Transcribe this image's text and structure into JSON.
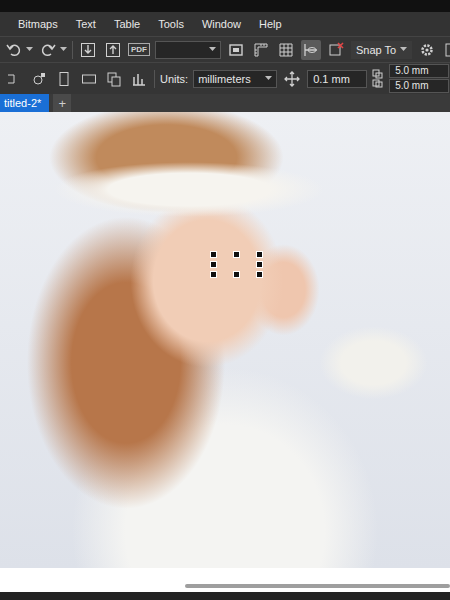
{
  "menu": [
    "Bitmaps",
    "Text",
    "Table",
    "Tools",
    "Window",
    "Help"
  ],
  "standard_toolbar": {
    "pdf_label": "PDF",
    "zoom_value": "",
    "view_toggle_on": true,
    "snap_to": "Snap To"
  },
  "property_bar": {
    "units_label": "Units:",
    "units": "millimeters",
    "nudge": "0.1 mm",
    "duplicate_x": "5.0 mm",
    "duplicate_y": "5.0 mm"
  },
  "tabs": [
    {
      "label": "titled-2*",
      "selected": true
    }
  ],
  "new_tab": "+",
  "canvas": {
    "object_selected": true
  },
  "scrollbar": {
    "start": 0.41,
    "level": 0.59
  }
}
